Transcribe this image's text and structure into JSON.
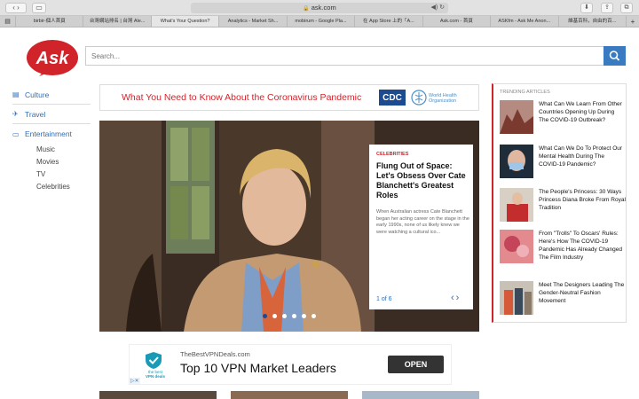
{
  "browser": {
    "url": "ask.com",
    "tabs": [
      {
        "label": "birbir-個人首頁",
        "active": false
      },
      {
        "label": "台灣網站排名 | 台灣 Ale...",
        "active": false
      },
      {
        "label": "What's Your Question?",
        "active": true
      },
      {
        "label": "Analytics - Market Sh...",
        "active": false
      },
      {
        "label": "mobirum - Google Pla...",
        "active": false
      },
      {
        "label": "在 App Store 上的「A...",
        "active": false
      },
      {
        "label": "Ask.com - 首頁",
        "active": false
      },
      {
        "label": "ASKfm - Ask Me Anon...",
        "active": false
      },
      {
        "label": "維基百科，自由的百...",
        "active": false
      }
    ]
  },
  "header": {
    "logo_text": "Ask",
    "search_placeholder": "Search..."
  },
  "sidebar": {
    "items": [
      {
        "label": "Culture",
        "icon": "culture-icon"
      },
      {
        "label": "Travel",
        "icon": "travel-icon"
      },
      {
        "label": "Entertainment",
        "icon": "entertainment-icon"
      }
    ],
    "subitems": [
      "Music",
      "Movies",
      "TV",
      "Celebrities"
    ]
  },
  "banner": {
    "text": "What You Need to Know About the Coronavirus Pandemic",
    "cdc": "CDC",
    "who_line1": "World Health",
    "who_line2": "Organization"
  },
  "hero": {
    "category": "CELEBRITIES",
    "title": "Flung Out of Space: Let's Obsess Over Cate Blanchett's Greatest Roles",
    "body": "When Australian actress Cate Blanchett began her acting career on the stage in the early 1990s, none of us likely knew we were watching a cultural ico...",
    "counter": "1 of 6",
    "slide_count": 6,
    "active_slide": 1
  },
  "trending": {
    "heading": "TRENDING ARTICLES",
    "items": [
      {
        "title": "What Can We Learn From Other Countries Opening Up During The COVID-19 Outbreak?",
        "color": "#8a4a3a"
      },
      {
        "title": "What Can We Do To Protect Our Mental Health During The COVID-19 Pandemic?",
        "color": "#2a5a9a"
      },
      {
        "title": "The People's Princess: 30 Ways Princess Diana Broke From Royal Tradition",
        "color": "#b03030"
      },
      {
        "title": "From \"Trolls\" To Oscars' Rules: Here's How The COVID-19 Pandemic Has Already Changed The Film Industry",
        "color": "#c2404a"
      },
      {
        "title": "Meet The Designers Leading The Gender-Neutral Fashion Movement",
        "color": "#4a5a6a"
      }
    ]
  },
  "ad": {
    "logo_line1": "the best",
    "logo_line2": "VPN deals",
    "url": "TheBestVPNDeals.com",
    "headline": "Top 10 VPN Market Leaders",
    "button": "OPEN"
  },
  "colors": {
    "accent": "#2d6fb7",
    "brand_red": "#d1232a",
    "search_button": "#3a7ac1"
  }
}
